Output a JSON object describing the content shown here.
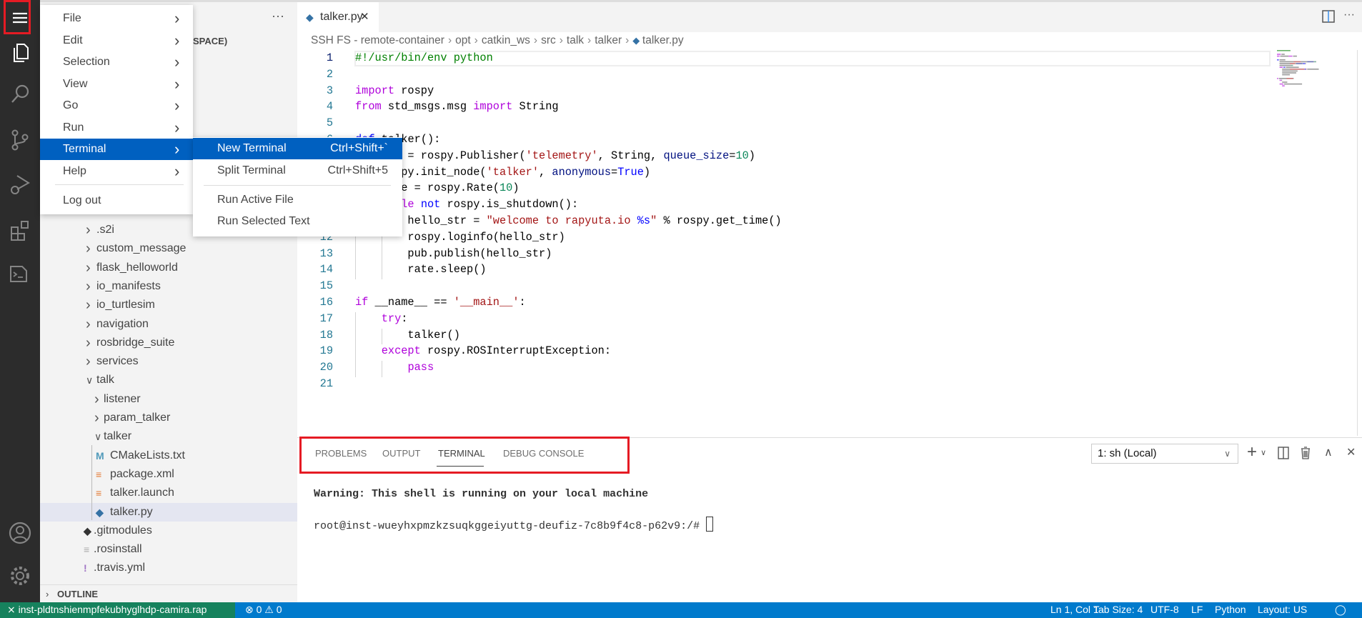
{
  "colors": {
    "accent": "#007acc",
    "remote": "#16825d",
    "menu_highlight": "#0060c0",
    "annotation": "#e51b24"
  },
  "activity_bar": {
    "icons": [
      "menu-icon",
      "files-icon",
      "search-icon",
      "source-control-icon",
      "run-debug-icon",
      "extensions-icon",
      "terminal-icon",
      "account-icon",
      "settings-gear-icon"
    ]
  },
  "sidebar": {
    "header_fragment": "SPACE)",
    "more_label": "···",
    "tree": [
      {
        "label": ".s2i",
        "type": "folder",
        "open": false,
        "depth": 1
      },
      {
        "label": "custom_message",
        "type": "folder",
        "open": false,
        "depth": 1
      },
      {
        "label": "flask_helloworld",
        "type": "folder",
        "open": false,
        "depth": 1
      },
      {
        "label": "io_manifests",
        "type": "folder",
        "open": false,
        "depth": 1
      },
      {
        "label": "io_turtlesim",
        "type": "folder",
        "open": false,
        "depth": 1
      },
      {
        "label": "navigation",
        "type": "folder",
        "open": false,
        "depth": 1
      },
      {
        "label": "rosbridge_suite",
        "type": "folder",
        "open": false,
        "depth": 1
      },
      {
        "label": "services",
        "type": "folder",
        "open": false,
        "depth": 1
      },
      {
        "label": "talk",
        "type": "folder",
        "open": true,
        "depth": 1
      },
      {
        "label": "listener",
        "type": "folder",
        "open": false,
        "depth": 2
      },
      {
        "label": "param_talker",
        "type": "folder",
        "open": false,
        "depth": 2
      },
      {
        "label": "talker",
        "type": "folder",
        "open": true,
        "depth": 2
      },
      {
        "label": "CMakeLists.txt",
        "type": "file",
        "icon": "M",
        "icon_color": "#519aba",
        "depth": 3
      },
      {
        "label": "package.xml",
        "type": "file",
        "icon": "≡",
        "icon_color": "#e37933",
        "depth": 3
      },
      {
        "label": "talker.launch",
        "type": "file",
        "icon": "≡",
        "icon_color": "#e37933",
        "depth": 3
      },
      {
        "label": "talker.py",
        "type": "file",
        "icon": "◆",
        "icon_color": "#3572a5",
        "depth": 3,
        "selected": true
      },
      {
        "label": ".gitmodules",
        "type": "file",
        "icon": "◆",
        "icon_color": "#333333",
        "depth": 0
      },
      {
        "label": ".rosinstall",
        "type": "file",
        "icon": "≡",
        "icon_color": "#aaaaaa",
        "depth": 0
      },
      {
        "label": ".travis.yml",
        "type": "file",
        "icon": "!",
        "icon_color": "#a074c4",
        "depth": 0
      }
    ],
    "outline_label": "OUTLINE"
  },
  "editor": {
    "tab": {
      "label": "talker.py",
      "close": "✕"
    },
    "breadcrumb": [
      "SSH FS - remote-container",
      "opt",
      "catkin_ws",
      "src",
      "talk",
      "talker",
      "talker.py"
    ],
    "lines": [
      [
        [
          "#!/usr/bin/env python",
          "cm"
        ]
      ],
      [],
      [
        [
          "import",
          "kw"
        ],
        [
          " rospy",
          ""
        ]
      ],
      [
        [
          "from",
          "kw"
        ],
        [
          " std_msgs.msg ",
          ""
        ],
        [
          "import",
          "kw"
        ],
        [
          " String",
          ""
        ]
      ],
      [],
      [
        [
          "def",
          "bl"
        ],
        [
          " talker():",
          ""
        ]
      ],
      [
        [
          "    pub = rospy.Publisher(",
          ""
        ],
        [
          "'telemetry'",
          "st"
        ],
        [
          ", String, ",
          ""
        ],
        [
          "queue_size",
          "pa"
        ],
        [
          "=",
          ""
        ],
        [
          "10",
          "nu"
        ],
        [
          ")",
          ""
        ]
      ],
      [
        [
          "    rospy.init_node(",
          ""
        ],
        [
          "'talker'",
          "st"
        ],
        [
          ", ",
          ""
        ],
        [
          "anonymous",
          "pa"
        ],
        [
          "=",
          ""
        ],
        [
          "True",
          "bl"
        ],
        [
          ")",
          ""
        ]
      ],
      [
        [
          "    rate = rospy.Rate(",
          ""
        ],
        [
          "10",
          "nu"
        ],
        [
          ")",
          ""
        ]
      ],
      [
        [
          "    ",
          ""
        ],
        [
          "while",
          "kw"
        ],
        [
          " ",
          ""
        ],
        [
          "not",
          "bl"
        ],
        [
          " rospy.is_shutdown():",
          ""
        ]
      ],
      [
        [
          "        hello_str = ",
          ""
        ],
        [
          "\"welcome to rapyuta.io ",
          "st"
        ],
        [
          "%s",
          "bl"
        ],
        [
          "\"",
          "st"
        ],
        [
          " % rospy.get_time()",
          ""
        ]
      ],
      [
        [
          "        rospy.loginfo(hello_str)",
          ""
        ]
      ],
      [
        [
          "        pub.publish(hello_str)",
          ""
        ]
      ],
      [
        [
          "        rate.sleep()",
          ""
        ]
      ],
      [],
      [
        [
          "if",
          "kw"
        ],
        [
          " __name__ == ",
          ""
        ],
        [
          "'__main__'",
          "st"
        ],
        [
          ":",
          ""
        ]
      ],
      [
        [
          "    ",
          ""
        ],
        [
          "try",
          "kw"
        ],
        [
          ":",
          ""
        ]
      ],
      [
        [
          "        talker()",
          ""
        ]
      ],
      [
        [
          "    ",
          ""
        ],
        [
          "except",
          "kw"
        ],
        [
          " rospy.ROSInterruptException:",
          ""
        ]
      ],
      [
        [
          "        ",
          ""
        ],
        [
          "pass",
          "kw"
        ]
      ],
      []
    ]
  },
  "panel": {
    "tabs": [
      "PROBLEMS",
      "OUTPUT",
      "TERMINAL",
      "DEBUG CONSOLE"
    ],
    "active_tab": "TERMINAL",
    "terminal_select": "1: sh (Local)",
    "terminal_lines": [
      "Warning: This shell is running on your local machine",
      "root@inst-wueyhxpmzkzsuqkggeiyuttg-deufiz-7c8b9f4c8-p62v9:/# "
    ]
  },
  "menu": {
    "items": [
      {
        "label": "File",
        "submenu": true
      },
      {
        "label": "Edit",
        "submenu": true
      },
      {
        "label": "Selection",
        "submenu": true
      },
      {
        "label": "View",
        "submenu": true
      },
      {
        "label": "Go",
        "submenu": true
      },
      {
        "label": "Run",
        "submenu": true
      },
      {
        "label": "Terminal",
        "submenu": true,
        "highlighted": true
      },
      {
        "label": "Help",
        "submenu": true
      }
    ],
    "logout": "Log out",
    "terminal_submenu": [
      {
        "label": "New Terminal",
        "shortcut": "Ctrl+Shift+`",
        "highlighted": true
      },
      {
        "label": "Split Terminal",
        "shortcut": "Ctrl+Shift+5"
      },
      {
        "label": "Run Active File",
        "shortcut": ""
      },
      {
        "label": "Run Selected Text",
        "shortcut": ""
      }
    ]
  },
  "statusbar": {
    "remote": "inst-pldtnshienmpfekubhyglhdp-camira.rap",
    "errors": "0",
    "warnings": "0",
    "right": [
      "Ln 1, Col 1",
      "Tab Size: 4",
      "UTF-8",
      "LF",
      "Python",
      "Layout: US"
    ]
  }
}
